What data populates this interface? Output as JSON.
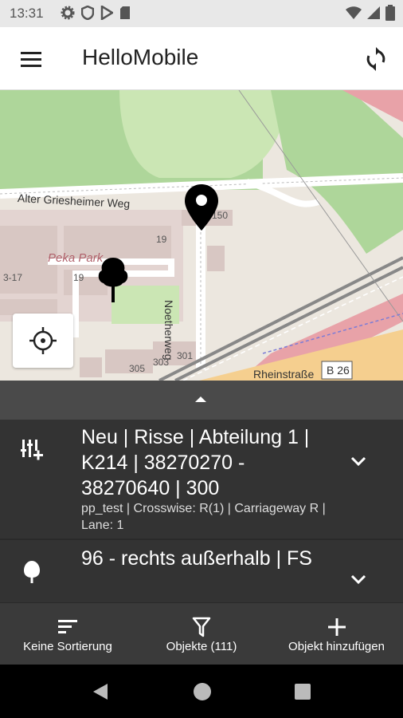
{
  "status_bar": {
    "time": "13:31",
    "left_icons": [
      "gear-icon",
      "shield-icon",
      "play-store-icon",
      "sd-card-icon"
    ],
    "right_icons": [
      "wifi-icon",
      "signal-icon",
      "battery-icon"
    ]
  },
  "app_bar": {
    "title": "HelloMobile",
    "menu_icon": "menu-icon",
    "sync_icon": "sync-icon"
  },
  "map": {
    "labels": {
      "street1": "Alter Griesheimer Weg",
      "street2": "Noetherweg",
      "street3": "Rheinstraße",
      "road_shield": "B 26",
      "park": "Peka Park",
      "h1": "150",
      "h2": "19",
      "h3": "19",
      "h4": "3-17",
      "h5": "305",
      "h6": "303",
      "h7": "301"
    },
    "marker_icon": "map-pin-icon",
    "tree_icon": "tree-icon",
    "locate_icon": "crosshair-icon"
  },
  "sheet": {
    "handle_icon": "chevron-up-icon"
  },
  "items": [
    {
      "icon": "sliders-add-icon",
      "title": "Neu | Risse | Abteilung 1 | K214 | 38270270 - 38270640 | 300",
      "subtitle": "pp_test | Crosswise: R(1) | Carriageway  R | Lane: 1"
    },
    {
      "icon": "tree-icon",
      "title": "96 - rechts außerhalb | FS",
      "subtitle": ""
    }
  ],
  "bottom_bar": {
    "sort_label": "Keine Sortierung",
    "filter_label": "Objekte (111)",
    "add_label": "Objekt hinzufügen"
  },
  "colors": {
    "park_green": "#cbe6b4",
    "forest_green": "#aed69a",
    "rail_pink": "#e8a2a8",
    "road_orange": "#f5cf8f",
    "list_bg": "#333333"
  }
}
